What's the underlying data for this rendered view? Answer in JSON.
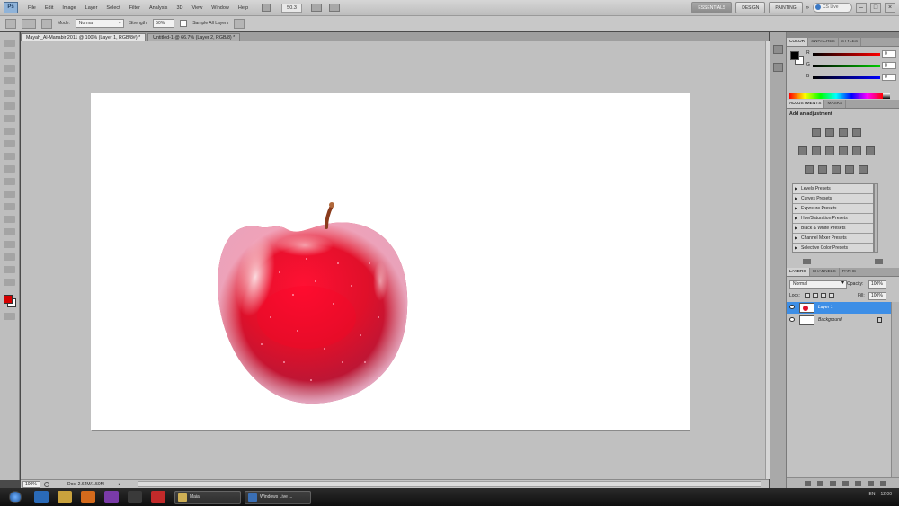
{
  "menubar": {
    "logo": "Ps",
    "items": [
      "File",
      "Edit",
      "Image",
      "Layer",
      "Select",
      "Filter",
      "Analysis",
      "3D",
      "View",
      "Window",
      "Help"
    ],
    "zoom_value": "50.3",
    "workspaces": [
      "ESSENTIALS",
      "DESIGN",
      "PAINTING"
    ],
    "cs_live": "CS Live"
  },
  "optionsbar": {
    "mode_label": "Mode:",
    "mode_value": "Normal",
    "strength_label": "Strength:",
    "strength_value": "50%",
    "sample_all_label": "Sample All Layers"
  },
  "documents": {
    "tabs": [
      {
        "label": "Mayah_Al-Manabir 2011 @ 100% (Layer 1, RGB/8#) *",
        "active": true
      },
      {
        "label": "Untitled-1 @ 66.7% (Layer 2, RGB/8) *",
        "active": false
      }
    ]
  },
  "statusbar": {
    "zoom": "100%",
    "doc_info": "Doc: 2.64M/1.50M"
  },
  "color_panel": {
    "tabs": [
      "COLOR",
      "SWATCHES",
      "STYLES"
    ],
    "channels": [
      {
        "name": "R",
        "value": "0",
        "color": "#ff0000"
      },
      {
        "name": "G",
        "value": "0",
        "color": "#00b000"
      },
      {
        "name": "B",
        "value": "0",
        "color": "#0000ff"
      }
    ]
  },
  "adjustments_panel": {
    "tabs": [
      "ADJUSTMENTS",
      "MASKS"
    ],
    "title": "Add an adjustment",
    "presets": [
      "Levels Presets",
      "Curves Presets",
      "Exposure Presets",
      "Hue/Saturation Presets",
      "Black & White Presets",
      "Channel Mixer Presets",
      "Selective Color Presets"
    ]
  },
  "layers_panel": {
    "tabs": [
      "LAYERS",
      "CHANNELS",
      "PATHS"
    ],
    "blend_mode": "Normal",
    "opacity_label": "Opacity:",
    "opacity_value": "100%",
    "lock_label": "Lock:",
    "fill_label": "Fill:",
    "fill_value": "100%",
    "layers": [
      {
        "name": "Layer 1",
        "selected": true
      },
      {
        "name": "Background",
        "selected": false
      }
    ]
  },
  "taskbar": {
    "tasks": [
      "Maia",
      "Windows Live ..."
    ],
    "tray": [
      "EN",
      "12:00"
    ]
  },
  "colors": {
    "foreground_swatch": "#d40000",
    "selection_blue": "#3d8ee6",
    "apple_red": "#e0102a"
  }
}
